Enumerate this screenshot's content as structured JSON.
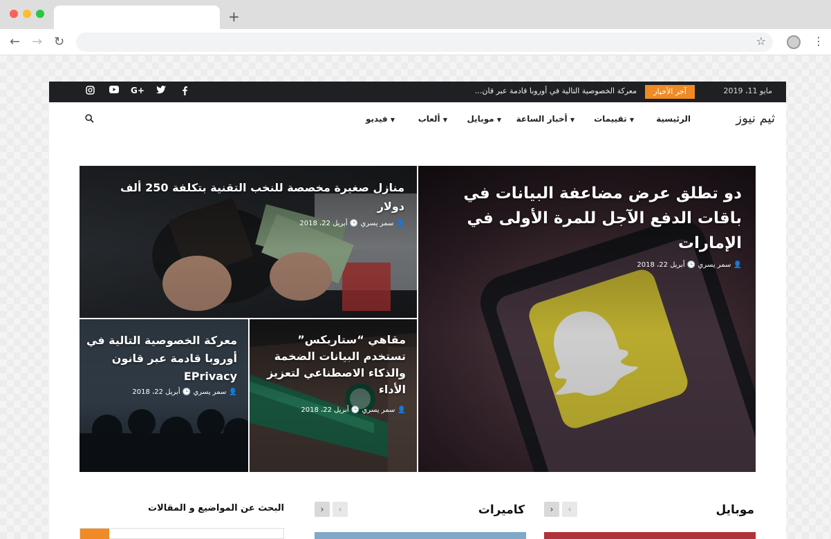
{
  "site": {
    "logo": "ثيم نيوز",
    "topbar": {
      "date": "مايو 11، 2019",
      "latest_label": "آخر الأخبار",
      "ticker": "معركة الخصوصية التالية في أوروبا قادمة عبر قان..."
    },
    "nav": [
      {
        "label": "الرئيسية",
        "has_dropdown": false
      },
      {
        "label": "تقييمات",
        "has_dropdown": true
      },
      {
        "label": "أخبار الساعة",
        "has_dropdown": true
      },
      {
        "label": "موبايل",
        "has_dropdown": true
      },
      {
        "label": "ألعاب",
        "has_dropdown": true
      },
      {
        "label": "فيديو",
        "has_dropdown": true
      }
    ],
    "social_icons": [
      "facebook-icon",
      "twitter-icon",
      "google-plus-icon",
      "youtube-icon",
      "instagram-icon"
    ]
  },
  "featured": {
    "main": {
      "title": "دو تطلق عرض مضاعفة البيانات في باقات الدفع الآجل للمرة الأولى في الإمارات",
      "author": "سمر يسري",
      "date": "أبريل 22، 2018"
    },
    "top": {
      "title": "منازل صغيرة مخصصة للنخب التقنية بتكلفة 250 ألف دولار",
      "author": "سمر يسري",
      "date": "أبريل 22، 2018"
    },
    "bottom_right": {
      "title": "مقاهي “ستاربكس” تستخدم البيانات الضخمة والذكاء الاصطناعي لتعزيز الأداء",
      "author": "سمر يسري",
      "date": "أبريل 22، 2018"
    },
    "bottom_left": {
      "title": "معركة الخصوصية التالية في أوروبا قادمة عبر قانون EPrivacy",
      "author": "سمر يسري",
      "date": "أبريل 22، 2018"
    }
  },
  "sections": {
    "mobile": "موبايل",
    "cameras": "كاميرات",
    "search": "البحث عن المواضيع و المقالات"
  },
  "colors": {
    "accent": "#f08a24",
    "topbar": "#1f2024"
  }
}
